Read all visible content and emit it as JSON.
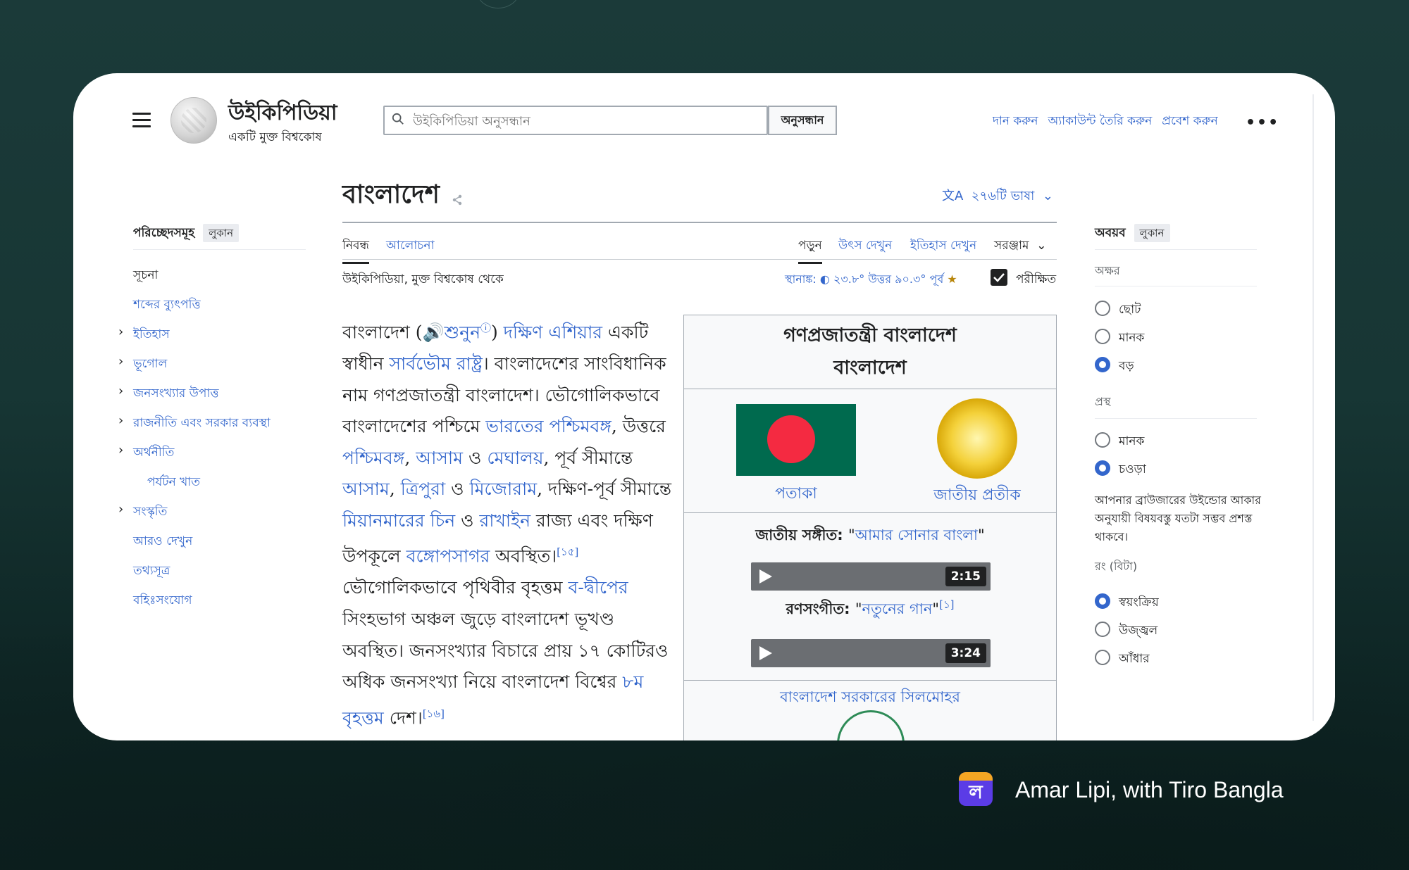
{
  "header": {
    "site_title": "উইকিপিডিয়া",
    "site_tagline": "একটি মুক্ত বিশ্বকোষ",
    "search_placeholder": "উইকিপিডিয়া অনুসন্ধান",
    "search_button": "অনুসন্ধান",
    "donate": "দান করুন",
    "create_account": "অ্যাকাউন্ট তৈরি করুন",
    "login": "প্রবেশ করুন",
    "more": "•••"
  },
  "article": {
    "title": "বাংলাদেশ",
    "languages": "২৭৬টি ভাষা",
    "tabs": [
      "নিবন্ধ",
      "আলোচনা"
    ],
    "views": [
      "পড়ুন",
      "উৎস দেখুন",
      "ইতিহাস দেখুন",
      "সরঞ্জাম"
    ],
    "from": "উইকিপিডিয়া, মুক্ত বিশ্বকোষ থেকে",
    "coords_label": "স্থানাঙ্ক:",
    "coords": "২৩.৮° উত্তর ৯০.৩° পূর্ব",
    "verified": "পরীক্ষিত"
  },
  "toc": {
    "heading": "পরিচ্ছেদসমূহ",
    "hide": "লুকান",
    "items": [
      "সূচনা",
      "শব্দের ব্যুৎপত্তি",
      "ইতিহাস",
      "ভূগোল",
      "জনসংখ্যার উপাত্ত",
      "রাজনীতি এবং সরকার ব্যবস্থা",
      "অর্থনীতি",
      "পর্যটন খাত",
      "সংস্কৃতি",
      "আরও দেখুন",
      "তথ্যসূত্র",
      "বহিঃসংযোগ"
    ]
  },
  "body": {
    "t1": "বাংলাদেশ (",
    "listen": "শুনুন",
    "t2": ") ",
    "l_south_asia": "দক্ষিণ এশিয়ার",
    "t3": " একটি স্বাধীন ",
    "l_sovereign": "সার্বভৌম রাষ্ট্র",
    "t4": "। বাংলাদেশের সাংবিধানিক নাম গণপ্রজাতন্ত্রী বাংলাদেশ। ভৌগোলিকভাবে বাংলাদেশের পশ্চিমে ",
    "l_wb_india": "ভারতের পশ্চিমবঙ্গ",
    "t5": ", উত্তরে ",
    "l_wb": "পশ্চিমবঙ্গ",
    "t6": ", ",
    "l_assam": "আসাম",
    "t7": " ও ",
    "l_meghalaya": "মেঘালয়",
    "t8": ", পূর্ব সীমান্তে ",
    "l_assam2": "আসাম",
    "t9": ", ",
    "l_tripura": "ত্রিপুরা",
    "t10": " ও ",
    "l_mizoram": "মিজোরাম",
    "t11": ", দক্ষিণ-পূর্ব সীমান্তে ",
    "l_myanmar": "মিয়ানমারের চিন",
    "t12": " ও ",
    "l_rakhine": "রাখাইন",
    "t13": " রাজ্য এবং দক্ষিণ উপকূলে ",
    "l_bay": "বঙ্গোপসাগর",
    "t14": " অবস্থিত।",
    "ref15": "[১৫]",
    "t15": " ভৌগোলিকভাবে পৃথিবীর বৃহত্তম ",
    "l_delta": "ব-দ্বীপের",
    "t16": " সিংহভাগ অঞ্চল জুড়ে বাংলাদেশ ভূখণ্ড অবস্থিত। জনসংখ্যার বিচারে প্রায় ১৭ কোটিরও অধিক জনসংখ্যা নিয়ে বাংলাদেশ বিশ্বের ",
    "l_8th": "৮ম বৃহত্তম",
    "t17": " দেশ।",
    "ref16": "[১৬]"
  },
  "infobox": {
    "title_line1": "গণপ্রজাতন্ত্রী বাংলাদেশ",
    "title_line2": "বাংলাদেশ",
    "flag_caption": "পতাকা",
    "emblem_caption": "জাতীয় প্রতীক",
    "anthem_label": "জাতীয় সঙ্গীত: ",
    "anthem_name": "আমার সোনার বাংলা",
    "audio1_time": "2:15",
    "march_label": "রণসংগীত: ",
    "march_name": "নতুনের গান",
    "march_ref": "[১]",
    "audio2_time": "3:24",
    "seal_caption": "বাংলাদেশ সরকারের সিলমোহর"
  },
  "appearance": {
    "heading": "অবয়ব",
    "hide": "লুকান",
    "text_label": "অক্ষর",
    "text_options": [
      "ছোট",
      "মানক",
      "বড়"
    ],
    "width_label": "প্রস্থ",
    "width_options": [
      "মানক",
      "চওড়া"
    ],
    "width_note": "আপনার ব্রাউজারের উইন্ডোর আকার অনুযায়ী বিষয়বস্তু যতটা সম্ভব প্রশস্ত থাকবে।",
    "color_label": "রং (বিটা)",
    "color_options": [
      "স্বয়ংক্রিয়",
      "উজ্জ্বল",
      "আঁধার"
    ]
  },
  "footer": {
    "logo_letter": "ল",
    "caption": "Amar Lipi, with Tiro Bangla"
  },
  "colors": {
    "link": "#3366cc",
    "background": "#173634",
    "flag_green": "#006a4e",
    "flag_red": "#f42a41"
  }
}
